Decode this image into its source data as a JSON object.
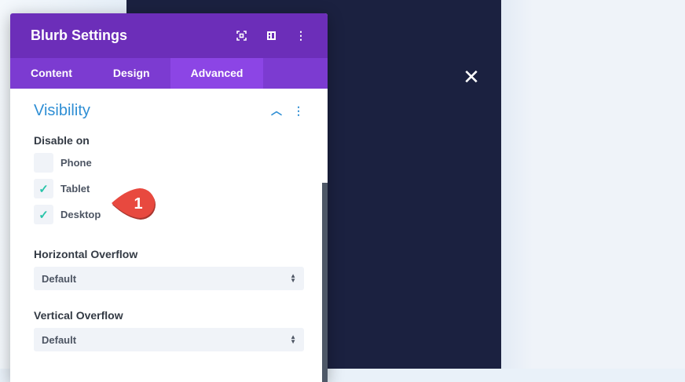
{
  "panel": {
    "title": "Blurb Settings",
    "tabs": [
      "Content",
      "Design",
      "Advanced"
    ],
    "active_tab": "Advanced"
  },
  "section": {
    "title": "Visibility",
    "disable_label": "Disable on",
    "options": [
      {
        "label": "Phone",
        "checked": false
      },
      {
        "label": "Tablet",
        "checked": true
      },
      {
        "label": "Desktop",
        "checked": true
      }
    ]
  },
  "fields": [
    {
      "label": "Horizontal Overflow",
      "value": "Default"
    },
    {
      "label": "Vertical Overflow",
      "value": "Default"
    }
  ],
  "annotation": {
    "number": "1",
    "color": "#e8493f"
  },
  "colors": {
    "header": "#6c2eb9",
    "tabs": "#7c3bd1",
    "accent": "#2e8ed4",
    "check": "#29c4a9"
  }
}
